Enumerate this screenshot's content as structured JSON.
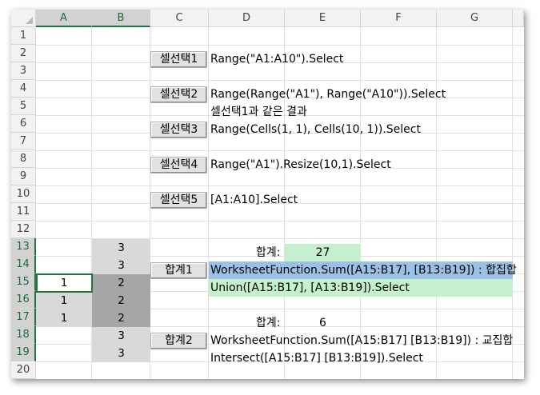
{
  "columns": [
    "A",
    "B",
    "C",
    "D",
    "E",
    "F",
    "G"
  ],
  "rows": [
    "1",
    "2",
    "3",
    "4",
    "5",
    "6",
    "7",
    "8",
    "9",
    "10",
    "11",
    "12",
    "13",
    "14",
    "15",
    "16",
    "17",
    "18",
    "19",
    "20"
  ],
  "buttons": {
    "select1": "셀선택1",
    "select2": "셀선택2",
    "select3": "셀선택3",
    "select4": "셀선택4",
    "select5": "셀선택5",
    "sum1": "합계1",
    "sum2": "합계2"
  },
  "code": {
    "r2": "Range(\"A1:A10\").Select",
    "r4": "Range(Range(\"A1\"), Range(\"A10\")).Select",
    "r5": "셀선택1과 같은 결과",
    "r6": "Range(Cells(1, 1), Cells(10, 1)).Select",
    "r8": "Range(\"A1\").Resize(10,1).Select",
    "r10": "[A1:A10].Select",
    "r14": "WorksheetFunction.Sum([A15:B17], [B13:B19]) : 합집합",
    "r15": "Union([A15:B17], [A13:B19]).Select",
    "r18": "WorksheetFunction.Sum([A15:B17]  [B13:B19]) : 교집합",
    "r19": "Intersect([A15:B17]  [B13:B19]).Select"
  },
  "totals": {
    "label1": "합계:",
    "value1": "27",
    "label2": "합계:",
    "value2": "6"
  },
  "cells": {
    "B13": "3",
    "B14": "3",
    "B15": "2",
    "B16": "2",
    "B17": "2",
    "B18": "3",
    "B19": "3",
    "A15": "1",
    "A16": "1",
    "A17": "1"
  },
  "colors": {
    "selection_header": "#217346",
    "light_gray_fill": "#d9d9d9",
    "dark_gray_fill": "#a6a6a6",
    "blue_highlight": "#9bc2e6",
    "green_highlight": "#c6efce"
  }
}
